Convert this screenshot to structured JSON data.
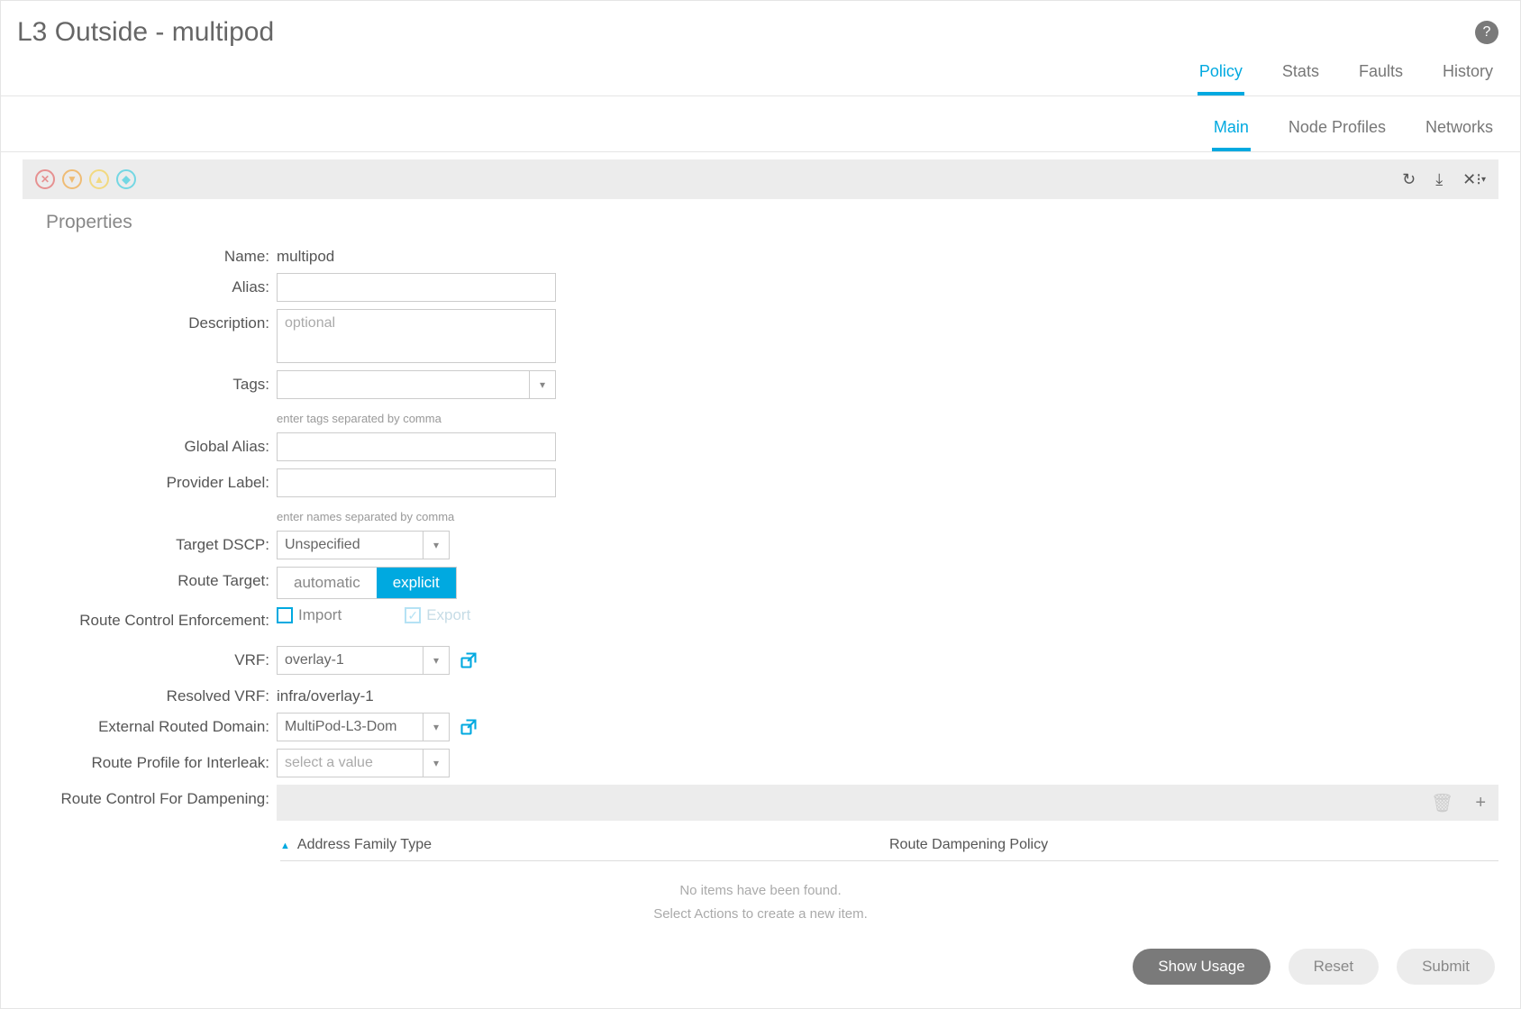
{
  "header": {
    "title": "L3 Outside - multipod"
  },
  "tabs1": {
    "items": [
      "Policy",
      "Stats",
      "Faults",
      "History"
    ],
    "active": 0
  },
  "tabs2": {
    "items": [
      "Main",
      "Node Profiles",
      "Networks"
    ],
    "active": 0
  },
  "section": {
    "properties": "Properties"
  },
  "form": {
    "name_label": "Name:",
    "name_value": "multipod",
    "alias_label": "Alias:",
    "alias_value": "",
    "description_label": "Description:",
    "description_placeholder": "optional",
    "description_value": "",
    "tags_label": "Tags:",
    "tags_value": "",
    "tags_hint": "enter tags separated by comma",
    "global_alias_label": "Global Alias:",
    "global_alias_value": "",
    "provider_label_label": "Provider Label:",
    "provider_label_value": "",
    "provider_label_hint": "enter names separated by comma",
    "target_dscp_label": "Target DSCP:",
    "target_dscp_value": "Unspecified",
    "route_target_label": "Route Target:",
    "route_target_options": [
      "automatic",
      "explicit"
    ],
    "route_target_selected": 1,
    "rce_label": "Route Control Enforcement:",
    "rce_import": "Import",
    "rce_import_checked": false,
    "rce_export": "Export",
    "rce_export_checked": true,
    "vrf_label": "VRF:",
    "vrf_value": "overlay-1",
    "resolved_vrf_label": "Resolved VRF:",
    "resolved_vrf_value": "infra/overlay-1",
    "ext_domain_label": "External Routed Domain:",
    "ext_domain_value": "MultiPod-L3-Dom",
    "interleak_label": "Route Profile for Interleak:",
    "interleak_placeholder": "select a value",
    "interleak_value": "",
    "dampening_label": "Route Control For Dampening:"
  },
  "dampening_table": {
    "col1": "Address Family Type",
    "col2": "Route Dampening Policy",
    "empty1": "No items have been found.",
    "empty2": "Select Actions to create a new item."
  },
  "footer": {
    "show_usage": "Show Usage",
    "reset": "Reset",
    "submit": "Submit"
  }
}
